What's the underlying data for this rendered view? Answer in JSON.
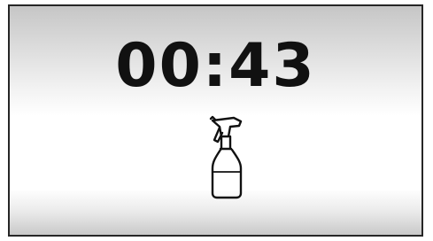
{
  "display": {
    "timer": "00:43",
    "program_icon": "spray-bottle-icon"
  }
}
